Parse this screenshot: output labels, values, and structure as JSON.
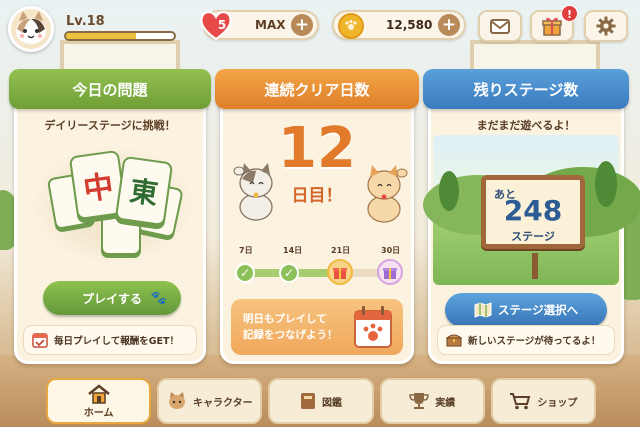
{
  "header": {
    "level": "Lv.18",
    "level_progress": 0.65,
    "hearts": "5",
    "hearts_status": "MAX",
    "coins": "12,580",
    "gift_badge": "!"
  },
  "daily": {
    "title": "今日の問題",
    "subtitle": "デイリーステージに挑戦！",
    "tiles": [
      "中",
      "東"
    ],
    "play_label": "プレイする",
    "footer": "毎日プレイして報酬をGET！"
  },
  "streak": {
    "title": "連続クリア日数",
    "days": "12",
    "days_unit": "日目！",
    "milestones": [
      "7日",
      "14日",
      "21日",
      "30日"
    ],
    "message_line1": "明日もプレイして",
    "message_line2": "記録をつなげよう！"
  },
  "remaining": {
    "title": "残りステージ数",
    "subtitle": "まだまだ遊べるよ！",
    "sign_prefix": "あと",
    "count": "248",
    "unit": "ステージ",
    "select_label": "ステージ選択へ",
    "footer": "新しいステージが待ってるよ！"
  },
  "nav": {
    "items": [
      "ホーム",
      "キャラクター",
      "図鑑",
      "実績",
      "ショップ"
    ]
  },
  "colors": {
    "green": "#7aa93f",
    "orange": "#e98f35",
    "blue": "#3f86c7",
    "heart": "#e84a4a",
    "coin": "#f1b52c"
  }
}
